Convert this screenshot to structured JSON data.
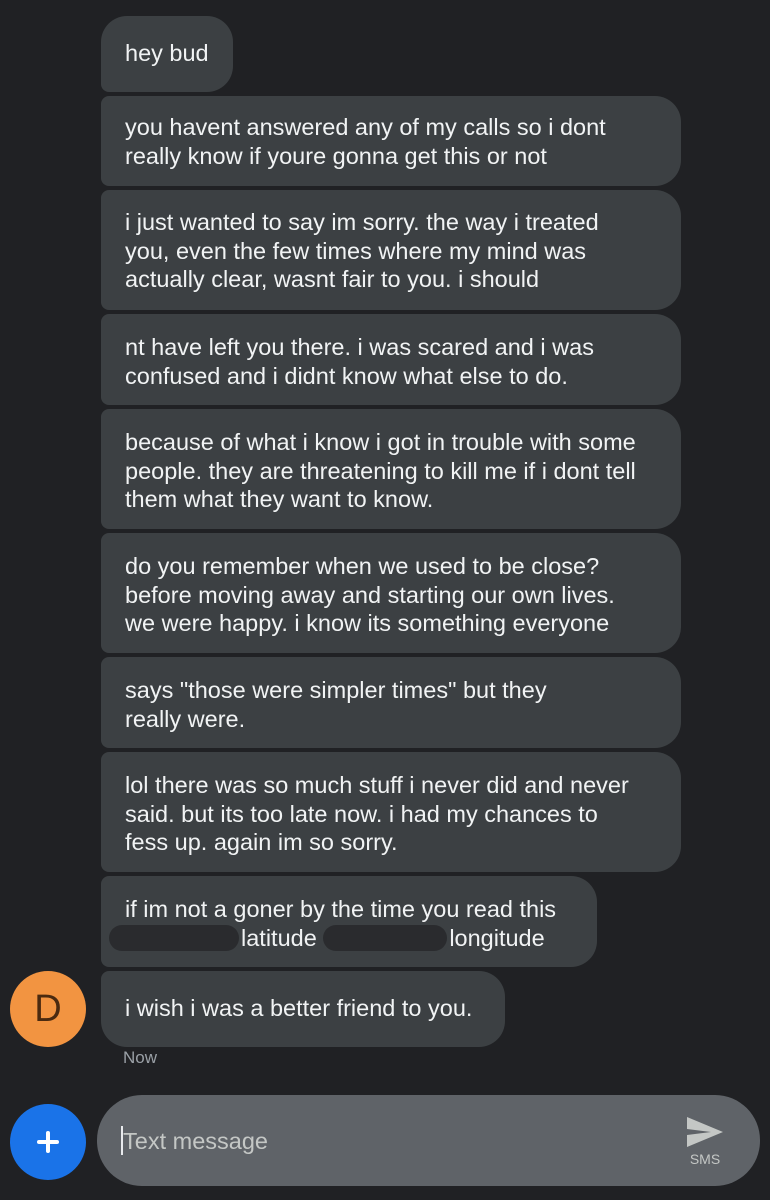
{
  "messages": [
    {
      "lines": [
        "hey bud"
      ]
    },
    {
      "lines": [
        "you havent answered any of my calls so i dont",
        "really know if youre gonna get this or not"
      ]
    },
    {
      "lines": [
        "i just wanted to say im sorry. the way i treated",
        "you, even the few times where my mind was",
        "actually clear, wasnt fair to you. i should"
      ]
    },
    {
      "lines": [
        "nt have left you there. i was scared and i was",
        "confused and i didnt know what else to do."
      ]
    },
    {
      "lines": [
        "because of what i know i got in trouble with some",
        "people. they are threatening to kill me if i dont tell",
        "them what they want to know."
      ]
    },
    {
      "lines": [
        "do you remember when we used to be close?",
        "before moving away and starting our own lives.",
        "we were happy. i know its something everyone"
      ]
    },
    {
      "lines": [
        "says \"those were simpler times\" but they",
        "really were."
      ]
    },
    {
      "lines": [
        "lol there was so much stuff i never did and never",
        "said. but its too late now. i had my chances to",
        "fess up. again im so sorry."
      ]
    },
    {
      "line1": "if im not a goner by the time you read this",
      "latitude_label": "latitude",
      "longitude_label": "longitude"
    },
    {
      "lines": [
        "i wish i was a better friend to you."
      ]
    }
  ],
  "sender": {
    "avatar_letter": "D",
    "avatar_color": "#f29441"
  },
  "timestamp": "Now",
  "compose": {
    "placeholder": "Text message",
    "send_mode_label": "SMS"
  },
  "icons": {
    "add": "plus-icon",
    "send": "send-icon"
  },
  "colors": {
    "background": "#202124",
    "bubble": "#3c4043",
    "compose": "#5f6368",
    "add_button": "#1a73e8"
  }
}
